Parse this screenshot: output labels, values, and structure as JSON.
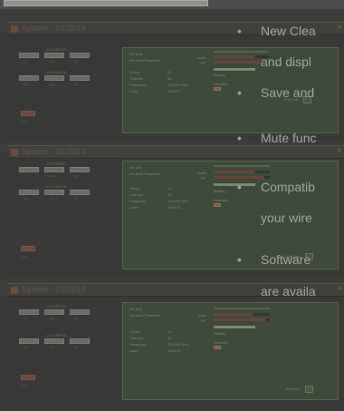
{
  "dialogs": [
    {
      "title": "System - 01/2014",
      "group_current": "CURRENT",
      "group_in_range": "IN RANGE",
      "current_btns": [
        "Ch",
        "Mute",
        "Sel"
      ],
      "range_btns": [
        "Scan",
        "Sync",
        "Set"
      ],
      "red_label": "Edit",
      "panel": {
        "header1": "RX Unit",
        "header2": "General Properties",
        "fields": [
          "Group",
          "Channel",
          "Frequency",
          "Label"
        ],
        "values": [
          "01",
          "04",
          "518.200 MHz",
          "AVSAT1"
        ],
        "audio": "Audio",
        "rf": "RF",
        "battery": "Battery",
        "diversity": "Diversity",
        "edit": "Edit Link",
        "scale": [
          "-30",
          "-20",
          "-10",
          "-6",
          "-3",
          "0"
        ],
        "battery_scale": [
          "1",
          "2",
          "3",
          "4"
        ]
      }
    },
    {
      "title": "System - 01/2014",
      "group_current": "CURRENT",
      "group_in_range": "IN RANGE",
      "current_btns": [
        "Ch",
        "Mute",
        "Sel"
      ],
      "range_btns": [
        "Scan",
        "Sync",
        "Set"
      ],
      "red_label": "Edit",
      "panel": {
        "header1": "RX Unit",
        "header2": "General Properties",
        "fields": [
          "Group",
          "Channel",
          "Frequency",
          "Label"
        ],
        "values": [
          "01",
          "04",
          "518.200 MHz",
          "AVSAT1"
        ],
        "audio": "Audio",
        "rf": "RF",
        "battery": "Battery",
        "diversity": "Diversity",
        "edit": "Edit Link",
        "scale": [
          "-30",
          "-20",
          "-10",
          "-6",
          "-3",
          "0"
        ],
        "battery_scale": [
          "1",
          "2",
          "3",
          "4"
        ]
      }
    },
    {
      "title": "System - 01/2014",
      "group_current": "CURRENT",
      "group_in_range": "IN RANGE",
      "current_btns": [
        "Ch",
        "Mute",
        "Sel"
      ],
      "range_btns": [
        "Scan",
        "Sync",
        "Set"
      ],
      "red_label": "Edit",
      "panel": {
        "header1": "RX Unit",
        "header2": "General Properties",
        "fields": [
          "Group",
          "Channel",
          "Frequency",
          "Label"
        ],
        "values": [
          "01",
          "04",
          "518.200 MHz",
          "AVSAT1"
        ],
        "audio": "Audio",
        "rf": "RF",
        "battery": "Battery",
        "diversity": "Diversity",
        "edit": "Edit Link",
        "scale": [
          "-30",
          "-20",
          "-10",
          "-6",
          "-3",
          "0"
        ],
        "battery_scale": [
          "1",
          "2",
          "3",
          "4"
        ]
      }
    }
  ],
  "overlay": {
    "bullet_char": "•",
    "lines": [
      "New Clea",
      "and displ",
      "Save and",
      "Mute func",
      "Compatib",
      "your wire",
      "Software",
      "are availa"
    ]
  },
  "colors": {
    "background": "#3b3b39",
    "overlay_text": "#a6a6a1",
    "panel": "#3d4a3a",
    "accent_red": "#6b4a3d"
  }
}
